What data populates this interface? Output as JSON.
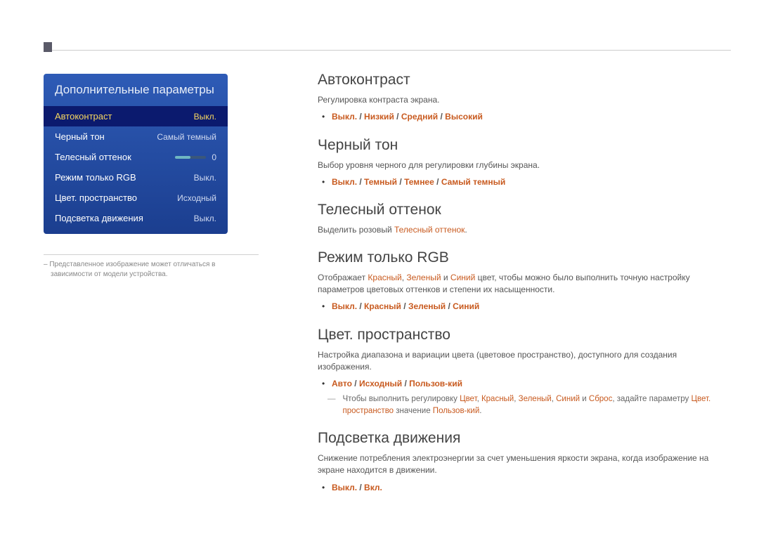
{
  "menu": {
    "title": "Дополнительные параметры",
    "items": [
      {
        "label": "Автоконтраст",
        "value": "Выкл.",
        "selected": true
      },
      {
        "label": "Черный тон",
        "value": "Самый темный"
      },
      {
        "label": "Телесный оттенок",
        "value": "0",
        "slider": true
      },
      {
        "label": "Режим только RGB",
        "value": "Выкл."
      },
      {
        "label": "Цвет. пространство",
        "value": "Исходный"
      },
      {
        "label": "Подсветка движения",
        "value": "Выкл."
      }
    ]
  },
  "footnote": "Представленное изображение может отличаться в зависимости от модели устройства.",
  "sections": {
    "auto": {
      "title": "Автоконтраст",
      "desc": "Регулировка контраста экрана.",
      "opts": [
        "Выкл.",
        "Низкий",
        "Средний",
        "Высокий"
      ]
    },
    "black": {
      "title": "Черный тон",
      "desc": "Выбор уровня черного для регулировки глубины экрана.",
      "opts": [
        "Выкл.",
        "Темный",
        "Темнее",
        "Самый темный"
      ]
    },
    "flesh": {
      "title": "Телесный оттенок",
      "desc_pre": "Выделить розовый ",
      "desc_hl": "Телесный оттенок",
      "desc_post": "."
    },
    "rgb": {
      "title": "Режим только RGB",
      "desc_pre": "Отображает ",
      "r": "Красный",
      "g": "Зеленый",
      "b": "Синий",
      "desc_mid": " цвет, чтобы можно было выполнить точную настройку параметров цветовых оттенков и степени их насыщенности.",
      "opts": [
        "Выкл.",
        "Красный",
        "Зеленый",
        "Синий"
      ]
    },
    "space": {
      "title": "Цвет. пространство",
      "desc": "Настройка диапазона и вариации цвета (цветовое пространство), доступного для создания изображения.",
      "opts": [
        "Авто",
        "Исходный",
        "Пользов-кий"
      ],
      "note_pre": "Чтобы выполнить регулировку ",
      "n1": "Цвет",
      "n2": "Красный",
      "n3": "Зеленый",
      "n4": "Синий",
      "note_and": " и ",
      "n5": "Сброс",
      "note_mid": ", задайте параметру ",
      "n6": "Цвет. пространство",
      "note_mid2": " значение ",
      "n7": "Пользов-кий",
      "note_post": "."
    },
    "motion": {
      "title": "Подсветка движения",
      "desc": "Снижение потребления электроэнергии за счет уменьшения яркости экрана, когда изображение на экране находится в движении.",
      "opts": [
        "Выкл.",
        "Вкл."
      ]
    }
  },
  "sep": " / ",
  "comma": ", "
}
